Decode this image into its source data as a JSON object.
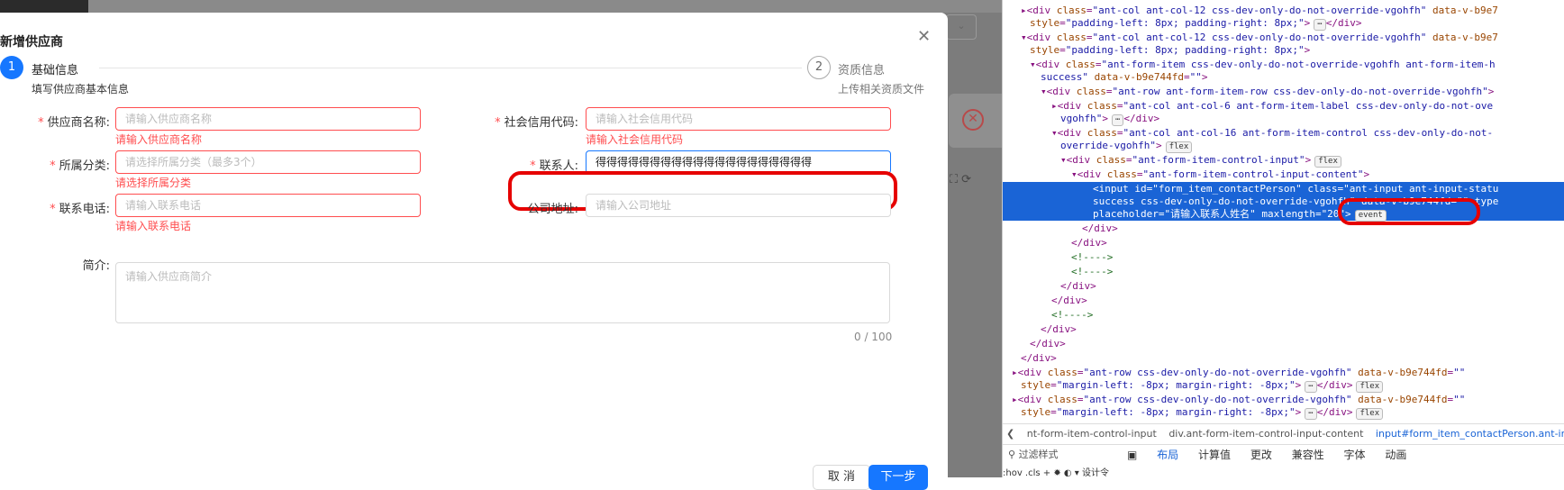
{
  "modal": {
    "title": "新增供应商",
    "close_icon": "close-icon",
    "steps": [
      {
        "num": "1",
        "title": "基础信息",
        "desc": "填写供应商基本信息"
      },
      {
        "num": "2",
        "title": "资质信息",
        "desc": "上传相关资质文件"
      }
    ],
    "fields": {
      "supplier_name": {
        "label": "供应商名称:",
        "placeholder": "请输入供应商名称",
        "error": "请输入供应商名称"
      },
      "credit_code": {
        "label": "社会信用代码:",
        "placeholder": "请输入社会信用代码",
        "error": "请输入社会信用代码"
      },
      "category": {
        "label": "所属分类:",
        "placeholder": "请选择所属分类（最多3个）",
        "error": "请选择所属分类"
      },
      "contact": {
        "label": "联系人:",
        "value": "得得得得得得得得得得得得得得得得得得得得"
      },
      "phone": {
        "label": "联系电话:",
        "placeholder": "请输入联系电话",
        "error": "请输入联系电话"
      },
      "address": {
        "label": "公司地址:",
        "placeholder": "请输入公司地址"
      },
      "intro": {
        "label": "简介:",
        "placeholder": "请输入供应商简介",
        "count": "0 / 100"
      }
    },
    "buttons": {
      "cancel": "取 消",
      "next": "下一步"
    },
    "accent": "#1677ff",
    "error_color": "#ff4d4f"
  },
  "devtools": {
    "crumbs": [
      "nt-form-item-control-input",
      "div.ant-form-item-control-input-content",
      "input#form_item_contactPerson.ant-input"
    ],
    "tabs": [
      "布局",
      "计算值",
      "更改",
      "兼容性",
      "字体",
      "动画"
    ],
    "filter": "过滤样式",
    "styles_bar": ":hov .cls + ✹ ◐   ▾ 设计令"
  }
}
